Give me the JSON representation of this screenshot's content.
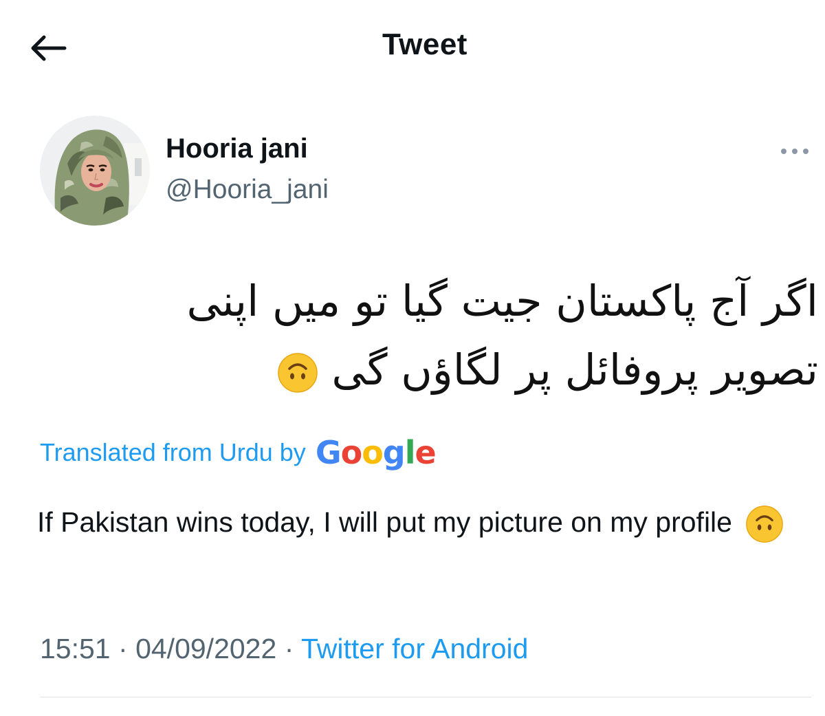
{
  "header": {
    "back_icon": "arrow-left-icon",
    "title": "Tweet"
  },
  "author": {
    "display_name": "Hooria jani",
    "handle": "@Hooria_jani",
    "more_icon": "more-horizontal-icon"
  },
  "tweet": {
    "text_urdu": "اگر آج پاکستان جیت گیا تو میں اپنی تصویر پروفائل پر لگاؤں گی",
    "emoji": "upside-down-face",
    "translated_label": "Translated from Urdu by",
    "translator_logo": "Google",
    "text_english": "If Pakistan wins today, I will put my picture on my profile",
    "time": "15:51",
    "date": "04/09/2022",
    "separator": "·",
    "source": "Twitter for Android"
  },
  "colors": {
    "accent": "#1d9bf0",
    "secondary_text": "#536471",
    "primary_text": "#0f1419"
  }
}
